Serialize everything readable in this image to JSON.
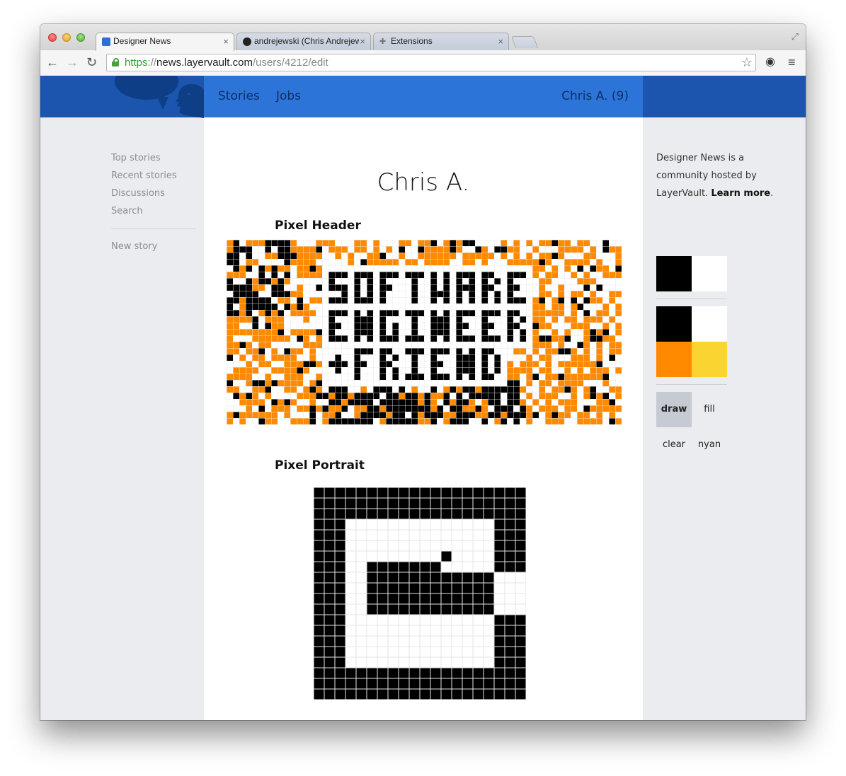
{
  "browser": {
    "tabs": [
      {
        "title": "Designer News",
        "icon": "designer-news-favicon",
        "active": true
      },
      {
        "title": "andrejewski (Chris Andrejewski)",
        "icon": "github-favicon",
        "active": false
      },
      {
        "title": "Extensions",
        "icon": "puzzle-piece-icon",
        "active": false
      }
    ],
    "close_glyph": "×",
    "url": {
      "scheme": "https",
      "sep": "://",
      "host": "news.layervault.com",
      "path": "/users/4212/edit"
    }
  },
  "site": {
    "nav": {
      "stories": "Stories",
      "jobs": "Jobs",
      "user": "Chris A. (9)"
    },
    "sidebar": {
      "items": [
        "Top stories",
        "Recent stories",
        "Discussions",
        "Search"
      ],
      "new_story": "New story"
    },
    "about": {
      "text": "Designer News is a community hosted by LayerVault.",
      "link": "Learn more",
      "end": "."
    }
  },
  "profile": {
    "name": "Chris A.",
    "pixel_header_title": "Pixel Header",
    "pixel_portrait_title": "Pixel Portrait"
  },
  "palette": {
    "colors": {
      "black": "#000000",
      "white": "#ffffff",
      "orange": "#ff8a00",
      "yellow": "#fad431"
    },
    "tools": {
      "draw": "draw",
      "fill": "fill",
      "clear": "clear",
      "nyan": "nyan"
    },
    "selected_tool": "draw"
  },
  "pixel_header": {
    "cols": 62,
    "rows": 29,
    "lines": [
      "SOFTWARE",
      "ENGINEER",
      "+FRIEND"
    ]
  },
  "pixel_portrait": {
    "rows": [
      "####################",
      "####################",
      "####################",
      "###..............###",
      "###..............###",
      "###..............###",
      "###.........#....###",
      "###..#######.....###",
      "###..############...",
      "###..############...",
      "###..############...",
      "###..############...",
      "###..............###",
      "###..............###",
      "###..............###",
      "###..............###",
      "###..............###",
      "####################",
      "####################",
      "####################"
    ]
  }
}
